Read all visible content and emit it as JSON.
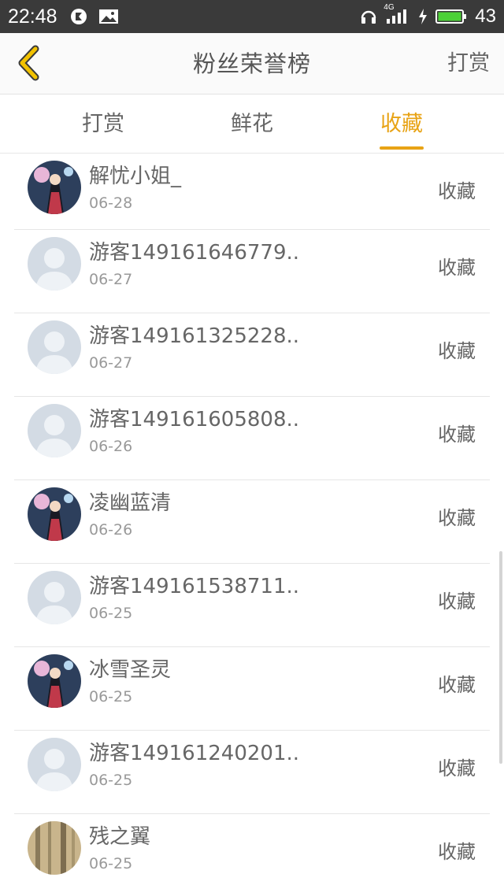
{
  "status_bar": {
    "time": "22:48",
    "network": "4G",
    "battery": "43",
    "icons": [
      "app-notification-icon",
      "image-icon",
      "headphones-icon",
      "signal-icon",
      "charging-icon",
      "battery-icon"
    ]
  },
  "nav": {
    "title": "粉丝荣誉榜",
    "right_action": "打赏",
    "back_icon": "chevron-left-icon",
    "accent_color": "#e8a315"
  },
  "tabs": [
    {
      "label": "打赏",
      "active": false
    },
    {
      "label": "鲜花",
      "active": false
    },
    {
      "label": "收藏",
      "active": true
    }
  ],
  "list": [
    {
      "name": "解忧小姐_",
      "date": "06-28",
      "action": "收藏",
      "avatar": "anime-avatar"
    },
    {
      "name": "游客149161646779..",
      "date": "06-27",
      "action": "收藏",
      "avatar": "default-avatar"
    },
    {
      "name": "游客149161325228..",
      "date": "06-27",
      "action": "收藏",
      "avatar": "default-avatar"
    },
    {
      "name": "游客149161605808..",
      "date": "06-26",
      "action": "收藏",
      "avatar": "default-avatar"
    },
    {
      "name": "凌幽蓝清",
      "date": "06-26",
      "action": "收藏",
      "avatar": "anime-avatar"
    },
    {
      "name": "游客149161538711..",
      "date": "06-25",
      "action": "收藏",
      "avatar": "default-avatar"
    },
    {
      "name": "冰雪圣灵",
      "date": "06-25",
      "action": "收藏",
      "avatar": "anime-avatar"
    },
    {
      "name": "游客149161240201..",
      "date": "06-25",
      "action": "收藏",
      "avatar": "default-avatar"
    },
    {
      "name": "残之翼",
      "date": "06-25",
      "action": "收藏",
      "avatar": "photo-avatar"
    }
  ]
}
